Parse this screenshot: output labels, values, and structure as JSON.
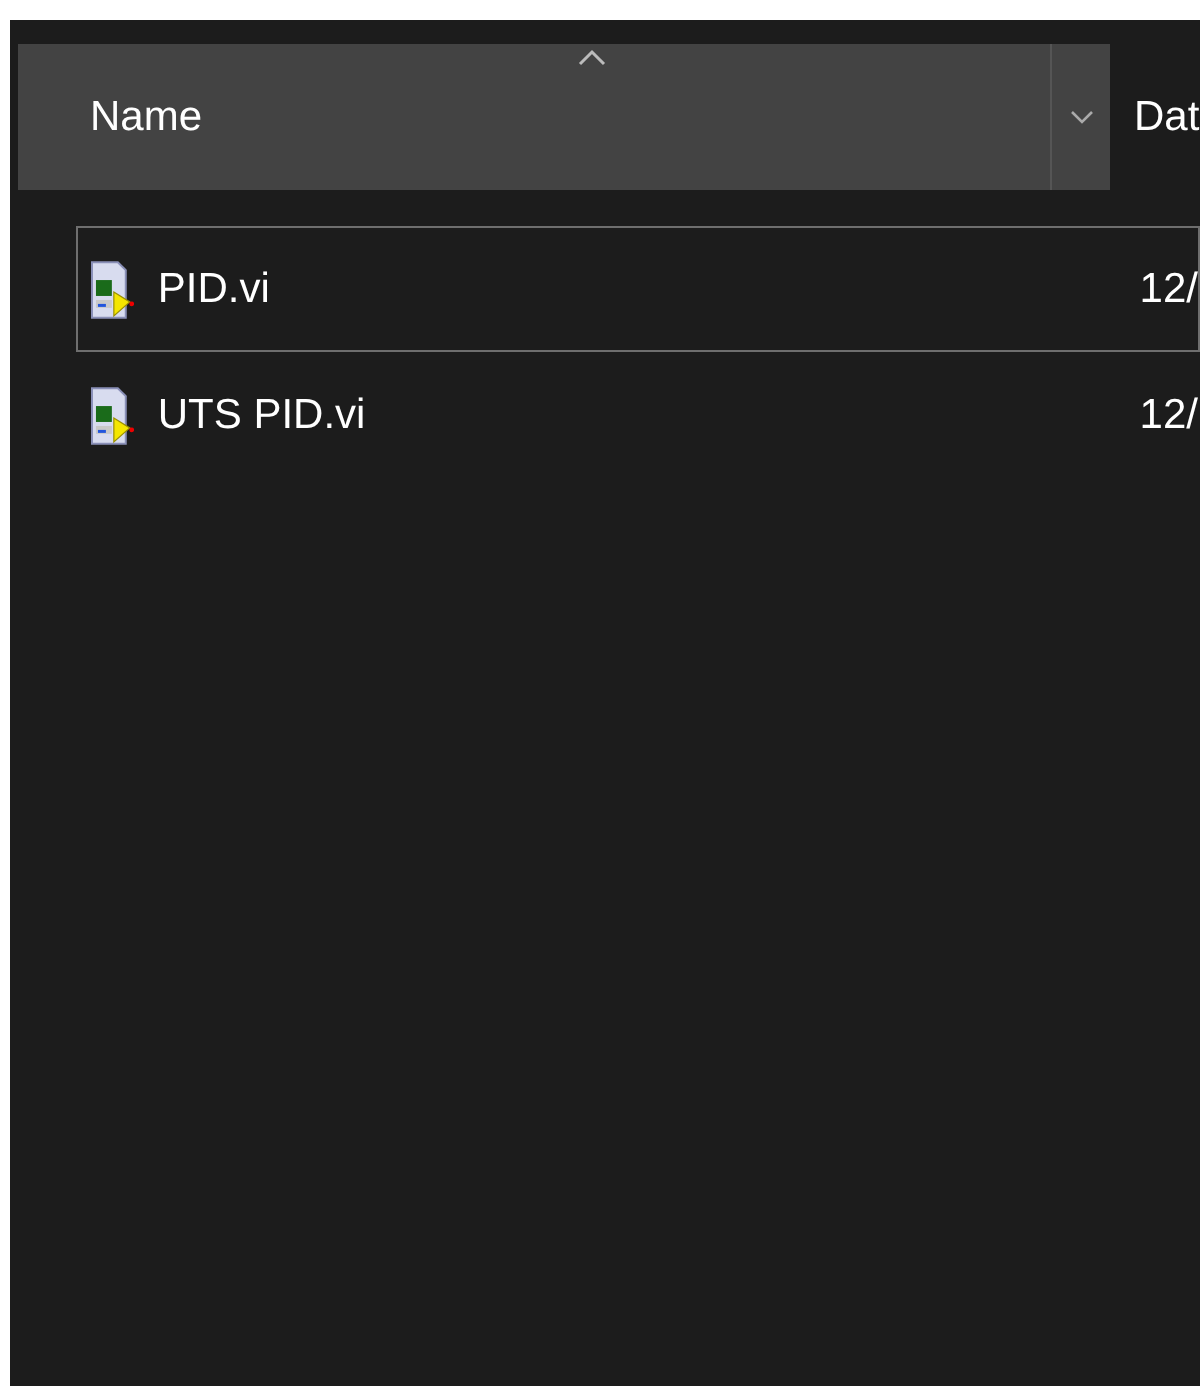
{
  "columns": [
    {
      "label": "Name",
      "sorted": true
    },
    {
      "label": "Dat",
      "sorted": false
    }
  ],
  "rows": [
    {
      "name": "PID.vi",
      "date": "12/",
      "focused": true
    },
    {
      "name": "UTS PID.vi",
      "date": "12/",
      "focused": false
    }
  ]
}
